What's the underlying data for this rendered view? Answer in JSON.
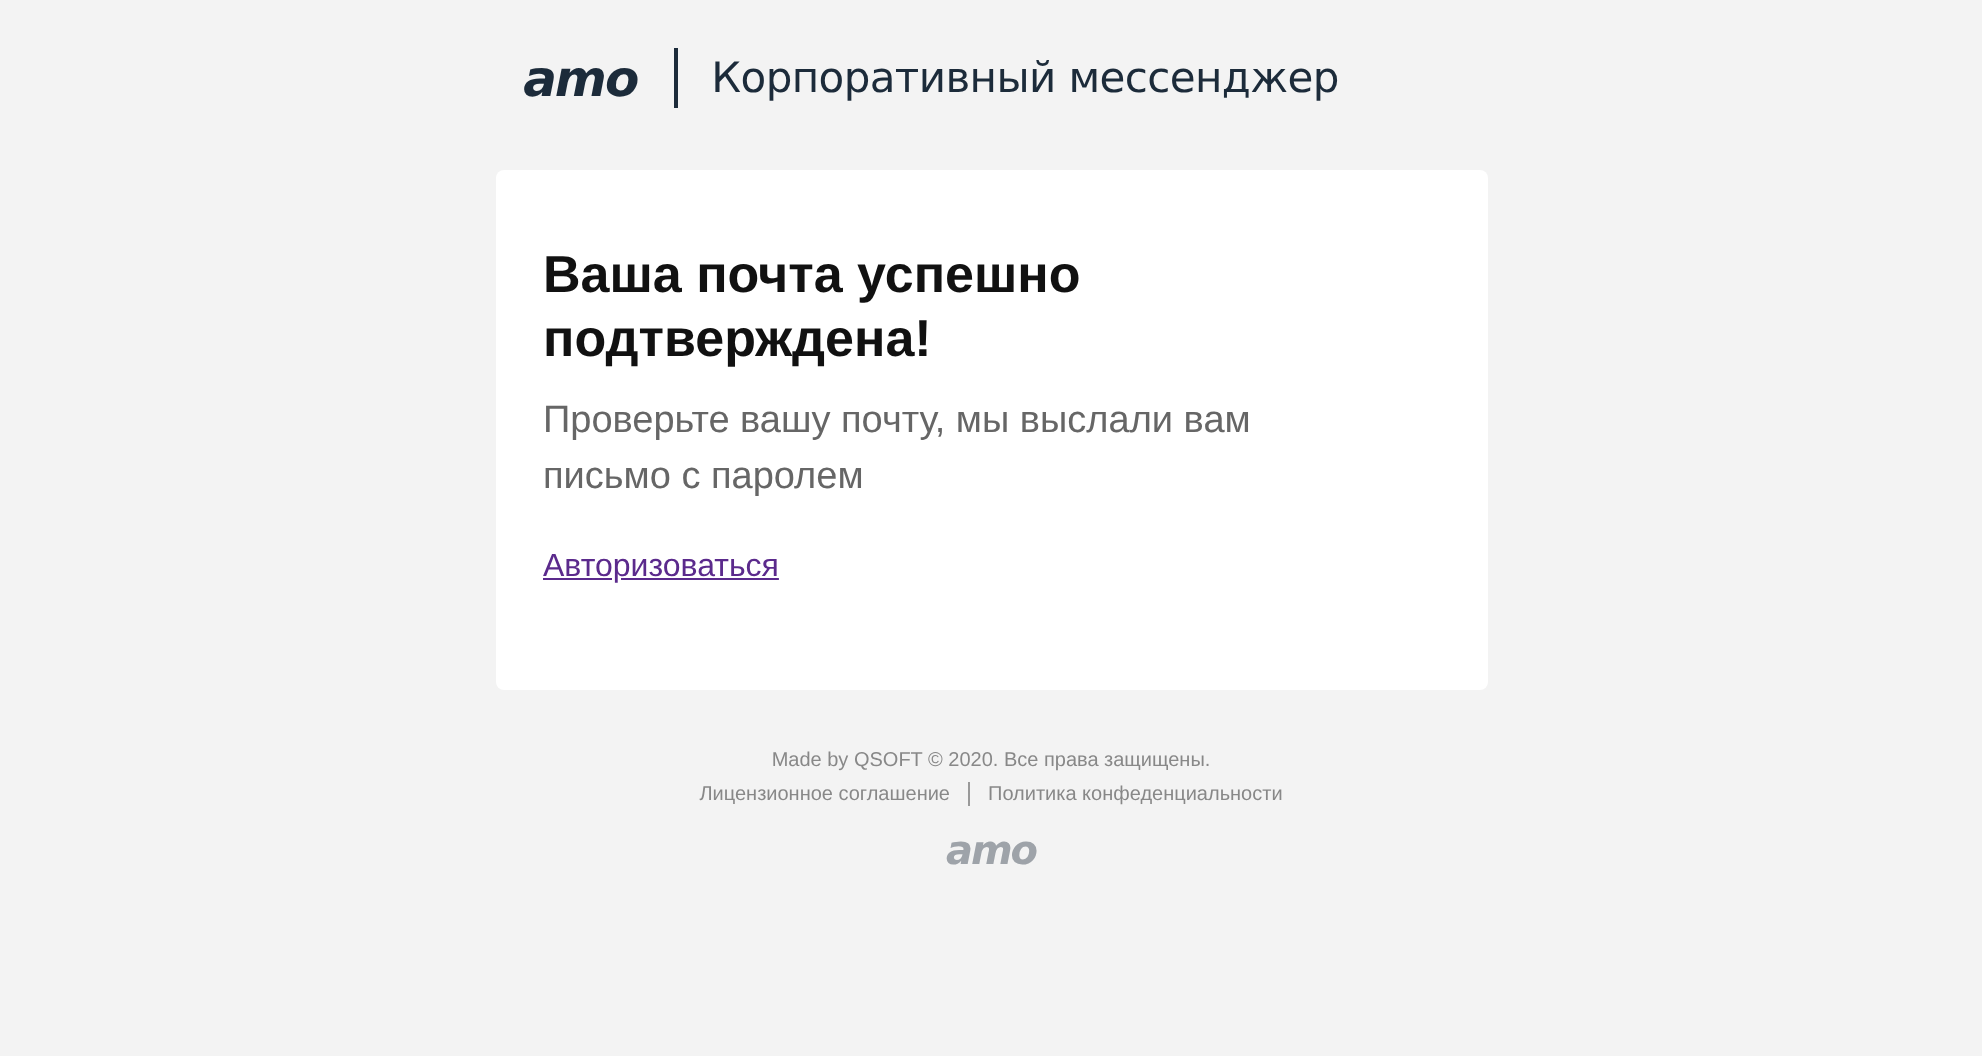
{
  "header": {
    "logo": "amo",
    "product": "Корпоративный мессенджер"
  },
  "card": {
    "title": "Ваша почта успешно подтверждена!",
    "message": "Проверьте вашу почту, мы выслали вам письмо с паролем",
    "link": "Авторизоваться"
  },
  "footer": {
    "copyright": "Made by QSOFT © 2020. Все права защищены.",
    "links": [
      "Лицензионное соглашение",
      "Политика конфеденциальности"
    ],
    "logo": "amo"
  }
}
